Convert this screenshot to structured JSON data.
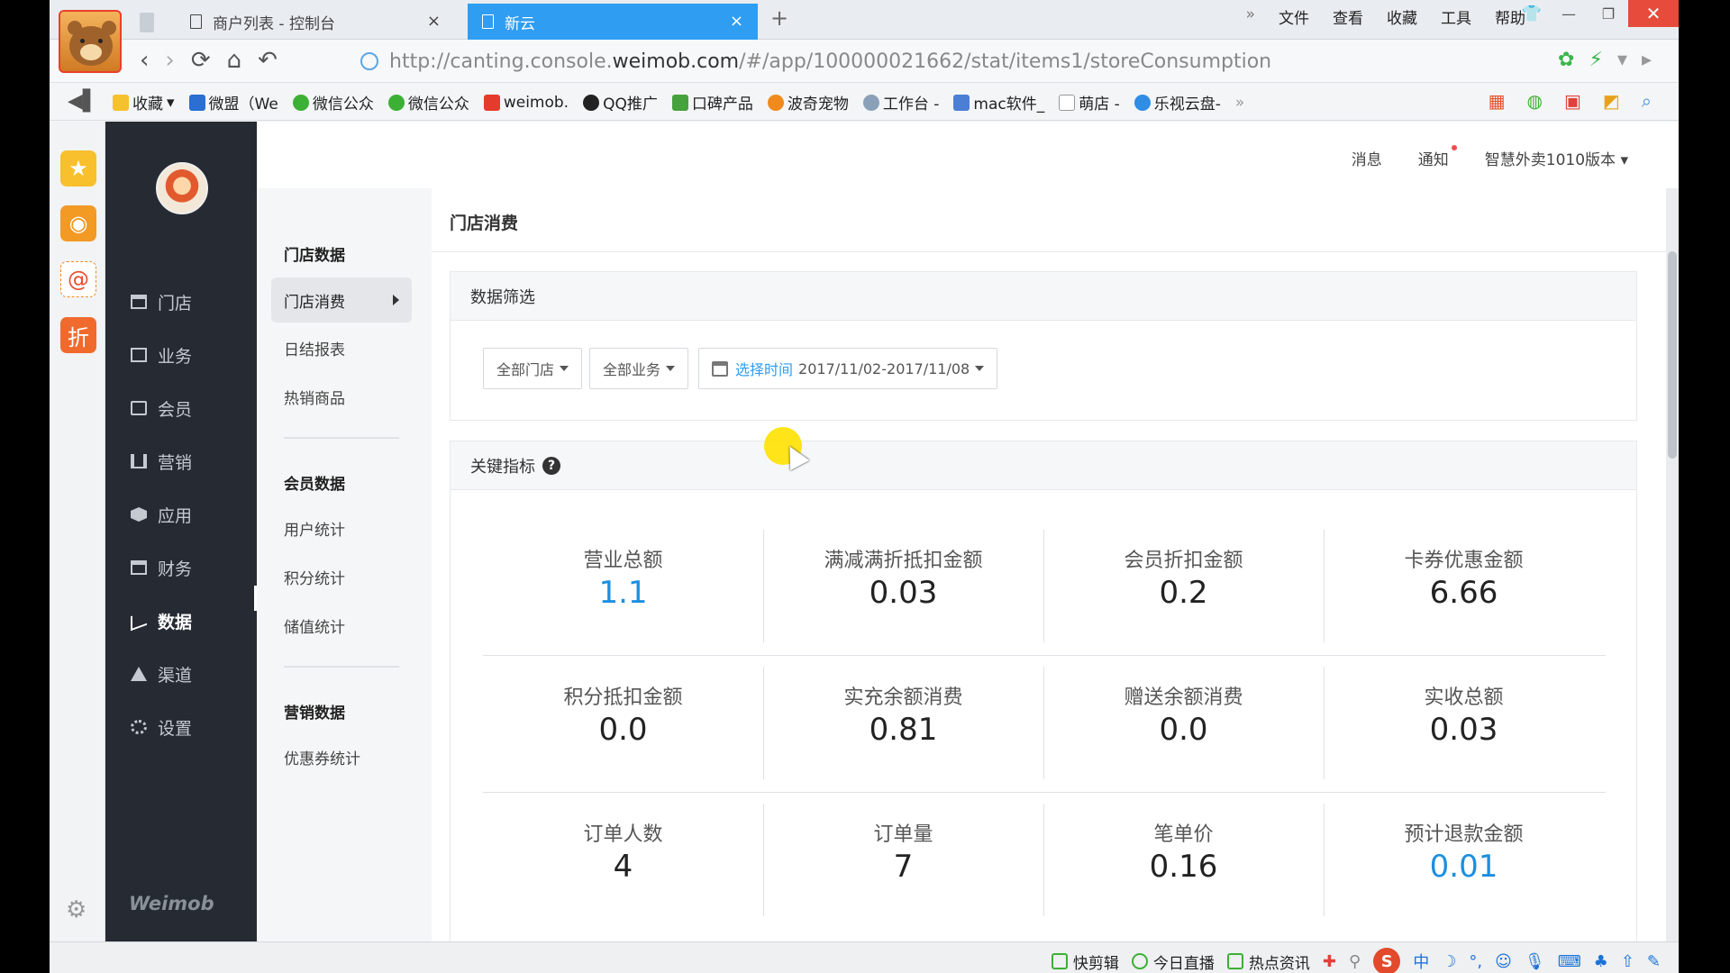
{
  "browser": {
    "tabs": [
      {
        "label": "商户列表 - 控制台",
        "close": "×"
      },
      {
        "label": "新云",
        "close": "×"
      }
    ],
    "new_tab": "+",
    "menu_more": "»",
    "menu": [
      "文件",
      "查看",
      "收藏",
      "工具",
      "帮助"
    ],
    "url_prefix": "http://canting.console.",
    "url_domain": "weimob.com",
    "url_path": "/#/app/100000021662/stat/items1/storeConsumption",
    "bookmarks": [
      "收藏",
      "微盟（We",
      "微信公众",
      "微信公众",
      "weimob.",
      "QQ推广",
      "口碑产品",
      "波奇宠物",
      "工作台 -",
      "mac软件_",
      "萌店 -",
      "乐视云盘-"
    ],
    "bookmarks_more": "»"
  },
  "header": {
    "messages": "消息",
    "notifications": "通知",
    "version": "智慧外卖1010版本"
  },
  "nav": {
    "items": [
      {
        "label": "门店"
      },
      {
        "label": "业务"
      },
      {
        "label": "会员"
      },
      {
        "label": "营销"
      },
      {
        "label": "应用"
      },
      {
        "label": "财务"
      },
      {
        "label": "数据"
      },
      {
        "label": "渠道"
      },
      {
        "label": "设置"
      }
    ],
    "active_index": 6,
    "brand": "Weimob"
  },
  "submenu": {
    "group1": "门店数据",
    "group1_items": [
      "门店消费",
      "日结报表",
      "热销商品"
    ],
    "group2": "会员数据",
    "group2_items": [
      "用户统计",
      "积分统计",
      "储值统计"
    ],
    "group3": "营销数据",
    "group3_items": [
      "优惠券统计"
    ]
  },
  "page": {
    "title": "门店消费",
    "filter_title": "数据筛选",
    "filter_store": "全部门店",
    "filter_business": "全部业务",
    "date_label": "选择时间",
    "date_range": "2017/11/02-2017/11/08",
    "kpi_title": "关键指标",
    "help": "?"
  },
  "kpis": [
    {
      "label": "营业总额",
      "value": "1.1",
      "highlight": true
    },
    {
      "label": "满减满折抵扣金额",
      "value": "0.03"
    },
    {
      "label": "会员折扣金额",
      "value": "0.2"
    },
    {
      "label": "卡券优惠金额",
      "value": "6.66"
    },
    {
      "label": "积分抵扣金额",
      "value": "0.0"
    },
    {
      "label": "实充余额消费",
      "value": "0.81"
    },
    {
      "label": "赠送余额消费",
      "value": "0.0"
    },
    {
      "label": "实收总额",
      "value": "0.03"
    },
    {
      "label": "订单人数",
      "value": "4"
    },
    {
      "label": "订单量",
      "value": "7"
    },
    {
      "label": "笔单价",
      "value": "0.16"
    },
    {
      "label": "预计退款金额",
      "value": "0.01",
      "highlight": true
    }
  ],
  "statusbar": {
    "items": [
      "快剪辑",
      "今日直播",
      "热点资讯"
    ],
    "ime": "中"
  },
  "colors": {
    "accent": "#2f9df2",
    "kpi_highlight": "#1b8fe0",
    "nav_bg": "#262b33"
  }
}
